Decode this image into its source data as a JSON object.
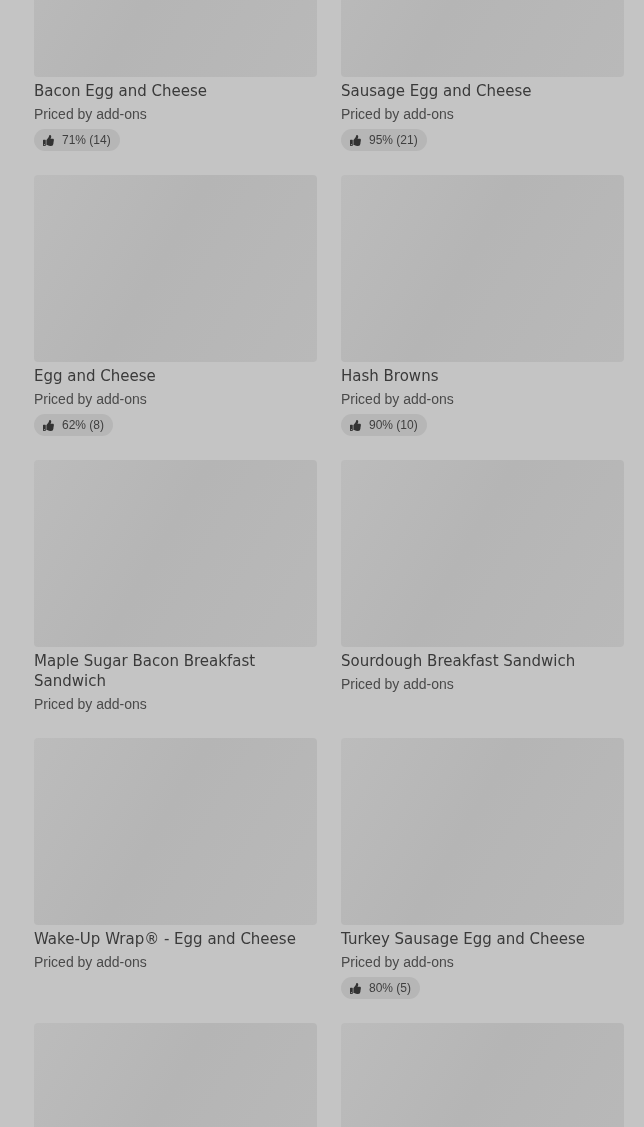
{
  "menu_items": [
    {
      "kind": "full",
      "title": "Bacon Egg and Cheese",
      "price": "Priced by add-ons",
      "rating": "71% (14)"
    },
    {
      "kind": "full",
      "title": "Sausage Egg and Cheese",
      "price": "Priced by add-ons",
      "rating": "95% (21)"
    },
    {
      "kind": "full",
      "title": "Egg and Cheese",
      "price": "Priced by add-ons",
      "rating": "62% (8)"
    },
    {
      "kind": "full",
      "title": "Hash Browns",
      "price": "Priced by add-ons",
      "rating": "90% (10)"
    },
    {
      "kind": "full",
      "title": "Maple Sugar Bacon Breakfast Sandwich",
      "price": "Priced by add-ons"
    },
    {
      "kind": "full",
      "title": "Sourdough Breakfast Sandwich",
      "price": "Priced by add-ons"
    },
    {
      "kind": "full",
      "title": "Wake-Up Wrap® - Egg and Cheese",
      "price": "Priced by add-ons"
    },
    {
      "kind": "full",
      "title": "Turkey Sausage Egg and Cheese",
      "price": "Priced by add-ons",
      "rating": "80% (5)"
    },
    {
      "kind": "image-only"
    },
    {
      "kind": "image-only"
    }
  ]
}
